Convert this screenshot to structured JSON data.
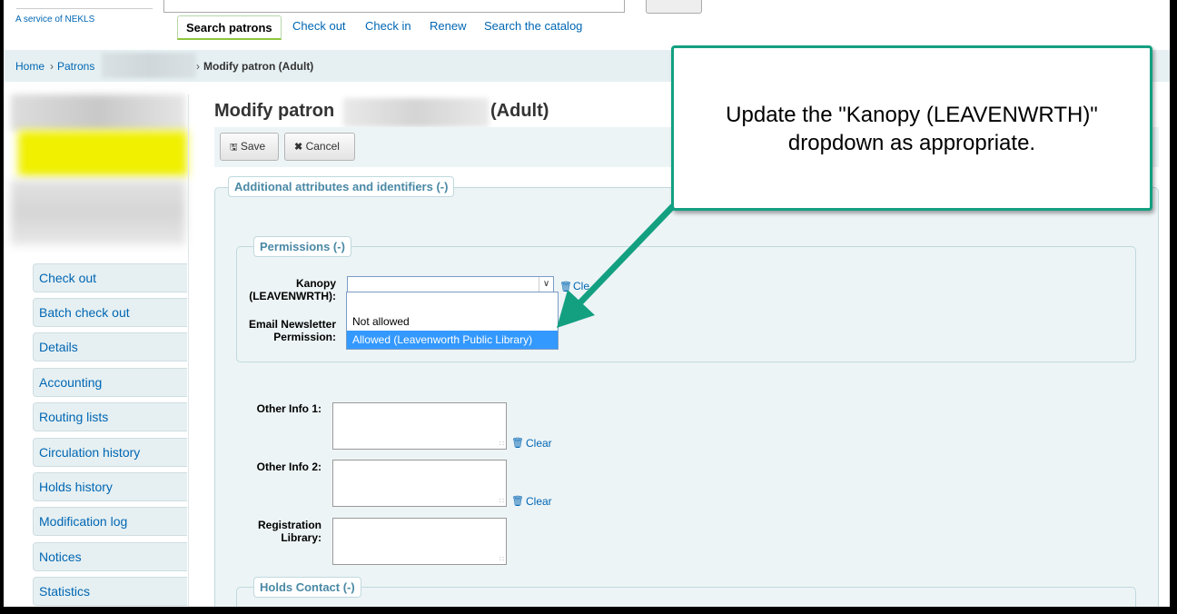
{
  "header": {
    "service_text": "A service of NEKLS",
    "tabs": [
      {
        "label": "Search patrons",
        "active": true
      },
      {
        "label": "Check out"
      },
      {
        "label": "Check in"
      },
      {
        "label": "Renew"
      },
      {
        "label": "Search the catalog"
      }
    ]
  },
  "breadcrumb": {
    "home": "Home",
    "sep": "›",
    "patrons": "Patrons",
    "current": "Modify patron (Adult)"
  },
  "sidebar": {
    "items": [
      {
        "label": "Check out"
      },
      {
        "label": "Batch check out"
      },
      {
        "label": "Details"
      },
      {
        "label": "Accounting"
      },
      {
        "label": "Routing lists"
      },
      {
        "label": "Circulation history"
      },
      {
        "label": "Holds history"
      },
      {
        "label": "Modification log"
      },
      {
        "label": "Notices"
      },
      {
        "label": "Statistics"
      }
    ]
  },
  "main": {
    "title_prefix": "Modify patron",
    "title_suffix": "(Adult)",
    "toolbar": {
      "save_label": "Save",
      "cancel_label": "Cancel"
    },
    "section_attributes": "Additional attributes and identifiers (-)",
    "section_permissions": "Permissions (-)",
    "section_holds": "Holds Contact (-)",
    "kanopy": {
      "label_line1": "Kanopy",
      "label_line2": "(LEAVENWRTH):",
      "selected_value": "",
      "options": [
        "",
        "Not allowed",
        "Allowed (Leavenworth Public Library)"
      ],
      "highlighted_option": "Allowed (Leavenworth Public Library)",
      "clear_label": "Cle"
    },
    "newsletter": {
      "label_line1": "Email Newsletter",
      "label_line2": "Permission:"
    },
    "other_info_1": {
      "label": "Other Info 1:",
      "value": "",
      "clear_label": "Clear"
    },
    "other_info_2": {
      "label": "Other Info 2:",
      "value": "",
      "clear_label": "Clear"
    },
    "registration_library": {
      "label_line1": "Registration",
      "label_line2": "Library:",
      "value": ""
    }
  },
  "callout": {
    "line1": "Update the \"Kanopy (LEAVENWRTH)\"",
    "line2": "dropdown as appropriate.",
    "border_color": "#13a081"
  },
  "colors": {
    "link": "#0066b3",
    "legend": "#4a89a5",
    "panel": "#edf4f6",
    "highlight": "#3399ff"
  }
}
